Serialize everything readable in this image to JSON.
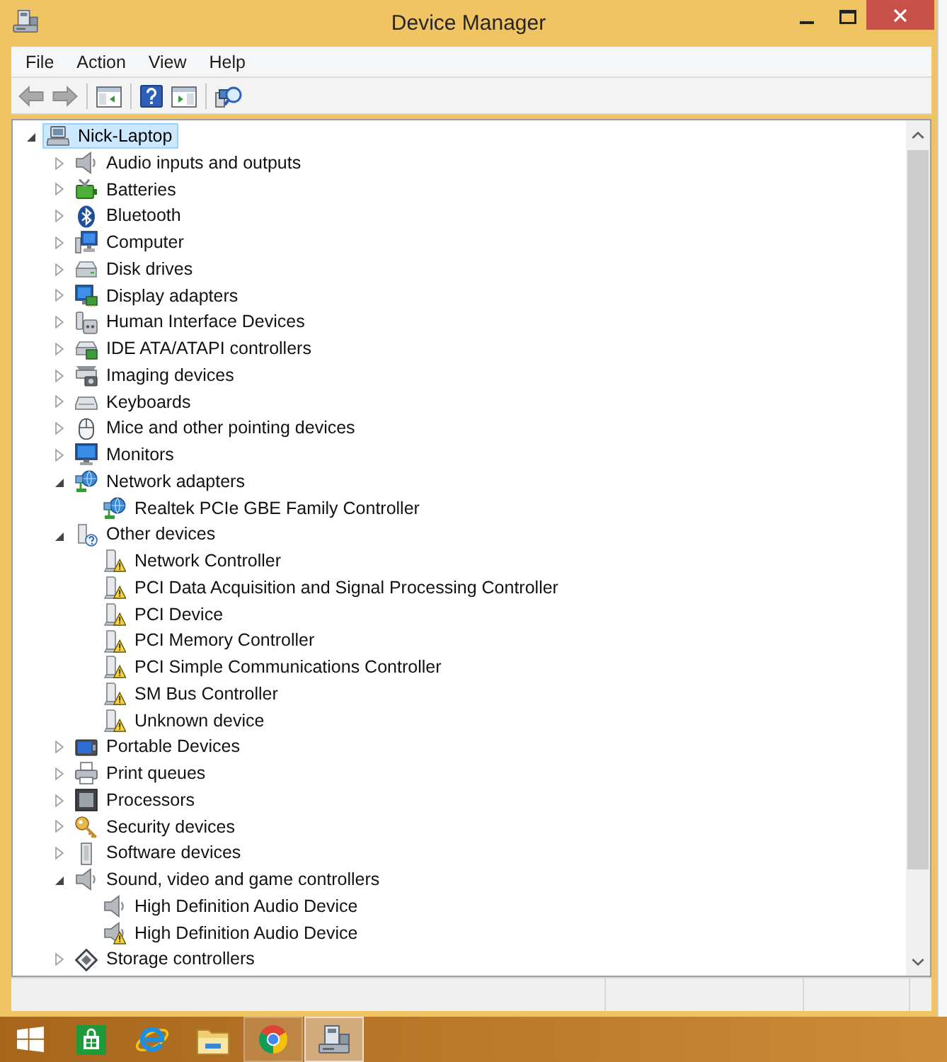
{
  "window": {
    "title": "Device Manager"
  },
  "menu": [
    "File",
    "Action",
    "View",
    "Help"
  ],
  "toolbar": [
    [
      {
        "kind": "back",
        "disabled": true
      },
      {
        "kind": "forward",
        "disabled": true
      }
    ],
    [
      {
        "kind": "tree_pane",
        "disabled": false
      }
    ],
    [
      {
        "kind": "help",
        "disabled": false
      },
      {
        "kind": "action_pane",
        "disabled": false
      }
    ],
    [
      {
        "kind": "scan",
        "disabled": false
      }
    ]
  ],
  "device_tree": {
    "label": "Nick-Laptop",
    "kind": "laptop",
    "expanded": true,
    "selected": true,
    "problem": false,
    "children": [
      {
        "label": "Audio inputs and outputs",
        "kind": "speaker",
        "expanded": false,
        "selected": false,
        "problem": false
      },
      {
        "label": "Batteries",
        "kind": "battery",
        "expanded": false,
        "selected": false,
        "problem": false
      },
      {
        "label": "Bluetooth",
        "kind": "bluetooth",
        "expanded": false,
        "selected": false,
        "problem": false
      },
      {
        "label": "Computer",
        "kind": "computer",
        "expanded": false,
        "selected": false,
        "problem": false
      },
      {
        "label": "Disk drives",
        "kind": "disk",
        "expanded": false,
        "selected": false,
        "problem": false
      },
      {
        "label": "Display adapters",
        "kind": "display",
        "expanded": false,
        "selected": false,
        "problem": false
      },
      {
        "label": "Human Interface Devices",
        "kind": "hid",
        "expanded": false,
        "selected": false,
        "problem": false
      },
      {
        "label": "IDE ATA/ATAPI controllers",
        "kind": "ide",
        "expanded": false,
        "selected": false,
        "problem": false
      },
      {
        "label": "Imaging devices",
        "kind": "imaging",
        "expanded": false,
        "selected": false,
        "problem": false
      },
      {
        "label": "Keyboards",
        "kind": "keyboard",
        "expanded": false,
        "selected": false,
        "problem": false
      },
      {
        "label": "Mice and other pointing devices",
        "kind": "mouse",
        "expanded": false,
        "selected": false,
        "problem": false
      },
      {
        "label": "Monitors",
        "kind": "monitor",
        "expanded": false,
        "selected": false,
        "problem": false
      },
      {
        "label": "Network adapters",
        "kind": "network",
        "expanded": true,
        "selected": false,
        "problem": false,
        "children": [
          {
            "label": "Realtek PCIe GBE Family Controller",
            "kind": "network",
            "selected": false,
            "problem": false
          }
        ]
      },
      {
        "label": "Other devices",
        "kind": "unknown",
        "expanded": true,
        "selected": false,
        "problem": false,
        "children": [
          {
            "label": "Network Controller",
            "kind": "device",
            "selected": false,
            "problem": true
          },
          {
            "label": "PCI Data Acquisition and Signal Processing Controller",
            "kind": "device",
            "selected": false,
            "problem": true
          },
          {
            "label": "PCI Device",
            "kind": "device",
            "selected": false,
            "problem": true
          },
          {
            "label": "PCI Memory Controller",
            "kind": "device",
            "selected": false,
            "problem": true
          },
          {
            "label": "PCI Simple Communications Controller",
            "kind": "device",
            "selected": false,
            "problem": true
          },
          {
            "label": "SM Bus Controller",
            "kind": "device",
            "selected": false,
            "problem": true
          },
          {
            "label": "Unknown device",
            "kind": "device",
            "selected": false,
            "problem": true
          }
        ]
      },
      {
        "label": "Portable Devices",
        "kind": "portable",
        "expanded": false,
        "selected": false,
        "problem": false
      },
      {
        "label": "Print queues",
        "kind": "printer",
        "expanded": false,
        "selected": false,
        "problem": false
      },
      {
        "label": "Processors",
        "kind": "processor",
        "expanded": false,
        "selected": false,
        "problem": false
      },
      {
        "label": "Security devices",
        "kind": "security",
        "expanded": false,
        "selected": false,
        "problem": false
      },
      {
        "label": "Software devices",
        "kind": "software",
        "expanded": false,
        "selected": false,
        "problem": false
      },
      {
        "label": "Sound, video and game controllers",
        "kind": "speaker",
        "expanded": true,
        "selected": false,
        "problem": false,
        "children": [
          {
            "label": "High Definition Audio Device",
            "kind": "speaker",
            "selected": false,
            "problem": false
          },
          {
            "label": "High Definition Audio Device",
            "kind": "speaker",
            "selected": false,
            "problem": true
          }
        ]
      },
      {
        "label": "Storage controllers",
        "kind": "storage",
        "expanded": false,
        "selected": false,
        "problem": false
      }
    ]
  },
  "taskbar": [
    {
      "kind": "start",
      "running": false,
      "active": false
    },
    {
      "kind": "store",
      "running": false,
      "active": false
    },
    {
      "kind": "ie",
      "running": false,
      "active": false
    },
    {
      "kind": "explorer",
      "running": false,
      "active": false
    },
    {
      "kind": "chrome",
      "running": true,
      "active": false
    },
    {
      "kind": "devices",
      "running": true,
      "active": true
    }
  ]
}
